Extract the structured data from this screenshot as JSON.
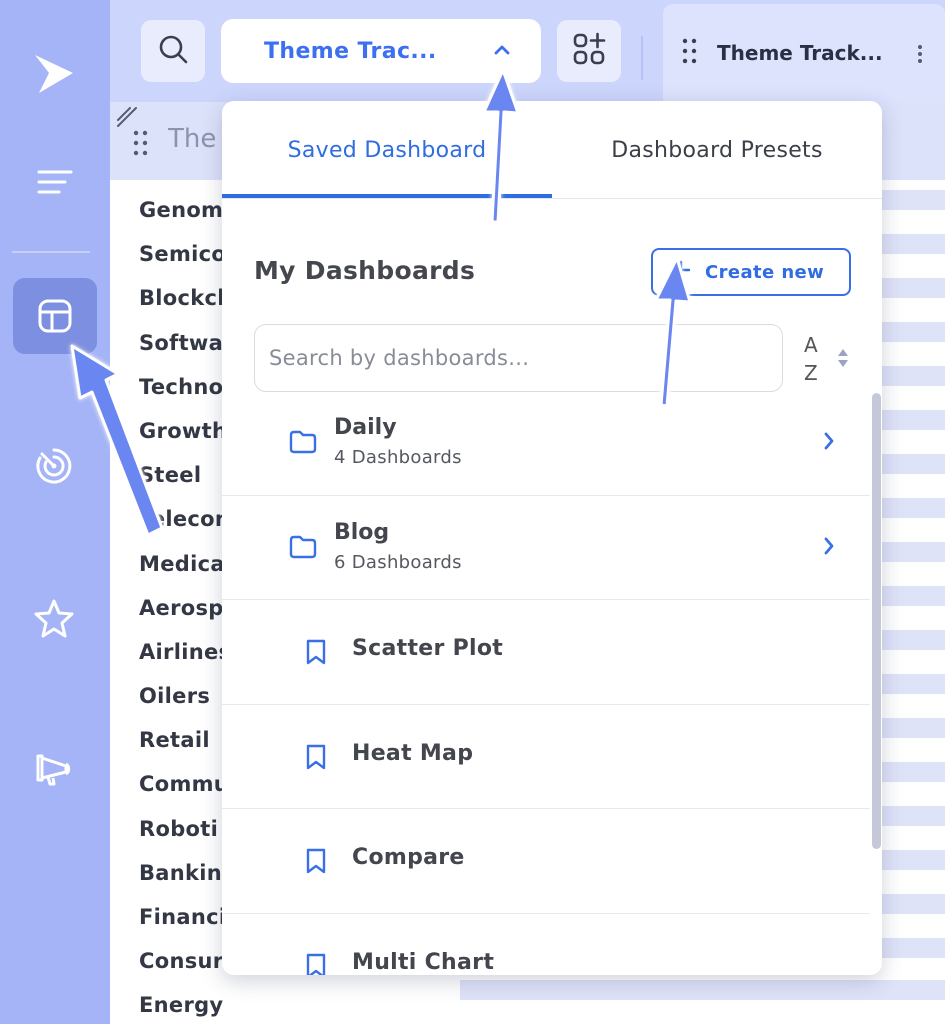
{
  "toolbar": {
    "theme_dropdown_label": "Theme Trac...",
    "active_tab_label": "Theme Track..."
  },
  "background_panel": {
    "title": "The",
    "themes": [
      "Genom",
      "Semico",
      "Blockch",
      "Softwa",
      "Techno",
      "Growth",
      "Steel",
      "Telecom",
      "Medica",
      "Aerosp",
      "Airlines",
      "Oilers",
      "Retail",
      "Commu",
      "Roboti",
      "Bankin",
      "Financi",
      "Consur",
      "Energy"
    ]
  },
  "dropdown": {
    "tabs": [
      {
        "label": "Saved Dashboard",
        "active": true
      },
      {
        "label": "Dashboard Presets",
        "active": false
      }
    ],
    "section_title": "My Dashboards",
    "create_button_label": "Create new",
    "search": {
      "placeholder": "Search by dashboards...",
      "value": ""
    },
    "sort": {
      "a": "A",
      "z": "Z"
    },
    "folders": [
      {
        "name": "Daily",
        "count": "4 Dashboards"
      },
      {
        "name": "Blog",
        "count": "6 Dashboards"
      }
    ],
    "saved": [
      "Scatter Plot",
      "Heat Map",
      "Compare",
      "Multi Chart"
    ]
  },
  "colors": {
    "accent": "#2f6de0",
    "rail": "#a5b4f6",
    "rail_active": "#7d8fe0",
    "annotation_arrow": "#6b86f0"
  },
  "icons": {
    "rail": [
      "logo-play-icon",
      "menu-lines-icon",
      "dashboard-layout-icon",
      "radar-icon",
      "star-icon",
      "megaphone-icon"
    ],
    "toolbar": [
      "search-icon",
      "chevron-up-icon",
      "add-widget-icon",
      "drag-grip-icon",
      "kebab-icon"
    ],
    "list": [
      "folder-icon",
      "chevron-right-icon",
      "bookmark-icon"
    ]
  }
}
